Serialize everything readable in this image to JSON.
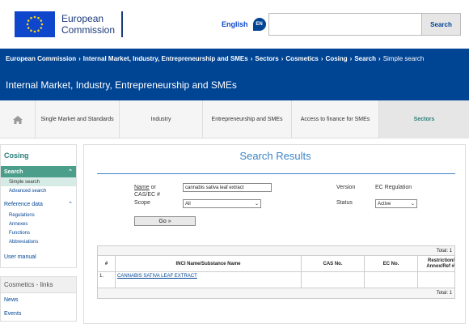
{
  "header": {
    "logo_line1": "European",
    "logo_line2": "Commission",
    "language_label": "English",
    "language_code": "EN",
    "search_placeholder": "",
    "search_button": "Search"
  },
  "breadcrumb": [
    "European Commission",
    "Internal Market, Industry, Entrepreneurship and SMEs",
    "Sectors",
    "Cosmetics",
    "Cosing",
    "Search",
    "Simple search"
  ],
  "banner_title": "Internal Market, Industry, Entrepreneurship and SMEs",
  "main_nav": {
    "items": [
      "Single Market and Standards",
      "Industry",
      "Entrepreneurship and SMEs",
      "Access to finance for SMEs",
      "Sectors"
    ]
  },
  "sidebar": {
    "title": "Cosing",
    "search_label": "Search",
    "search_sub": [
      "Simple search",
      "Advanced search"
    ],
    "reference_label": "Reference data",
    "reference_sub": [
      "Regulations",
      "Annexes",
      "Functions",
      "Abbreviations"
    ],
    "user_manual": "User manual",
    "links_title": "Cosmetics - links",
    "links": [
      "News",
      "Events"
    ]
  },
  "content": {
    "title": "Search Results",
    "form": {
      "name_label_underlined": "Name",
      "name_label_rest": " or",
      "cas_label": "CAS/EC #",
      "name_value": "cannabis sativa leaf extract",
      "scope_label": "Scope",
      "scope_value": "All",
      "version_label": "Version",
      "version_value": "EC Regulation",
      "status_label": "Status",
      "status_value": "Active",
      "go_button": "Go »"
    },
    "table": {
      "total_top": "Total: 1",
      "total_bottom": "Total: 1",
      "headers": [
        "#",
        "INCI Name/Substance Name",
        "CAS No.",
        "EC No.",
        "Restriction/ Annex/Ref #"
      ],
      "rows": [
        {
          "num": "1.",
          "name": "CANNABIS SATIVA LEAF EXTRACT",
          "cas": "",
          "ec": "",
          "ref": ""
        }
      ]
    }
  },
  "colors": {
    "brand_blue": "#004494",
    "accent_teal": "#4b9e89",
    "results_blue": "#3d85c6"
  }
}
